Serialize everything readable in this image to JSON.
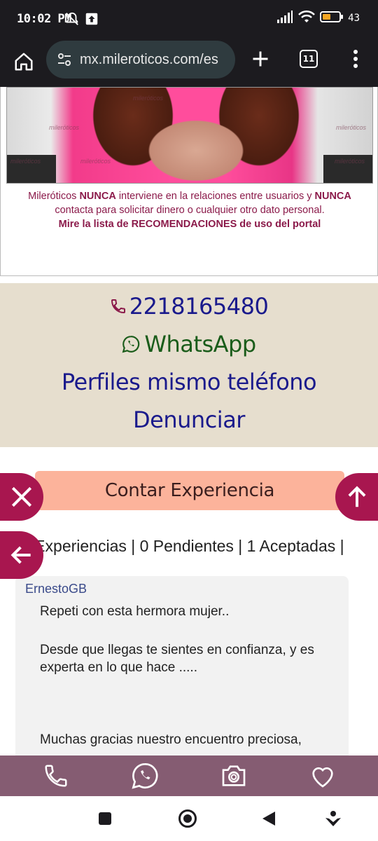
{
  "status_bar": {
    "time": "10:02 PM",
    "battery_text": "43"
  },
  "browser": {
    "url": "mx.mileroticos.com/es",
    "tab_count": "11"
  },
  "photo": {
    "watermark": "milerόticos"
  },
  "disclaimer": {
    "line1_a": "Mileróticos ",
    "line1_b": "NUNCA",
    "line1_c": " interviene en la relaciones entre usuarios y ",
    "line1_d": "NUNCA",
    "line2": "contacta para solicitar dinero o cualquier otro dato personal.",
    "line3": "Mire la lista de RECOMENDACIONES de uso del portal"
  },
  "contact": {
    "phone": "2218165480",
    "whatsapp": "WhatsApp",
    "same_phone_profiles": "Perfiles mismo teléfono",
    "report": "Denunciar"
  },
  "experience": {
    "button_label": "Contar Experiencia",
    "summary": "1 Experiencias | 0 Pendientes | 1 Aceptadas |"
  },
  "review": {
    "author": "ErnestoGB",
    "paragraphs": [
      "Repeti con esta hermora mujer..",
      "Desde que llegas te sientes en confianza, y es experta en lo que hace .....",
      "Muchas gracias nuestro encuentro preciosa,"
    ]
  },
  "colors": {
    "accent": "#a8164f",
    "bottom_bar": "#855c72",
    "contact_bg": "#e6dece",
    "tell_button": "#fcb39b"
  },
  "icons": {
    "bottom_bar": [
      "phone-icon",
      "whatsapp-icon",
      "camera-icon",
      "heart-icon"
    ],
    "floating": [
      "close-icon",
      "back-arrow-icon",
      "up-arrow-icon"
    ]
  }
}
